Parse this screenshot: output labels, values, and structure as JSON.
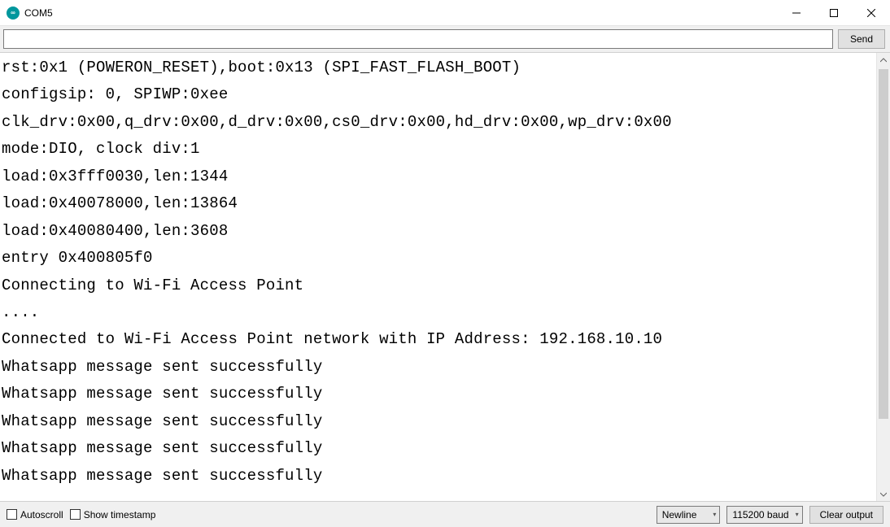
{
  "window": {
    "title": "COM5",
    "icon_label": "∞"
  },
  "toolbar": {
    "send_label": "Send",
    "input_value": ""
  },
  "console_lines": [
    "rst:0x1 (POWERON_RESET),boot:0x13 (SPI_FAST_FLASH_BOOT)",
    "configsip: 0, SPIWP:0xee",
    "clk_drv:0x00,q_drv:0x00,d_drv:0x00,cs0_drv:0x00,hd_drv:0x00,wp_drv:0x00",
    "mode:DIO, clock div:1",
    "load:0x3fff0030,len:1344",
    "load:0x40078000,len:13864",
    "load:0x40080400,len:3608",
    "entry 0x400805f0",
    "Connecting to Wi-Fi Access Point",
    "....",
    "Connected to Wi-Fi Access Point network with IP Address: 192.168.10.10",
    "Whatsapp message sent successfully",
    "Whatsapp message sent successfully",
    "Whatsapp message sent successfully",
    "Whatsapp message sent successfully",
    "Whatsapp message sent successfully"
  ],
  "footer": {
    "autoscroll_label": "Autoscroll",
    "autoscroll_checked": false,
    "timestamp_label": "Show timestamp",
    "timestamp_checked": false,
    "line_ending_selected": "Newline",
    "baud_selected": "115200 baud",
    "clear_label": "Clear output"
  }
}
